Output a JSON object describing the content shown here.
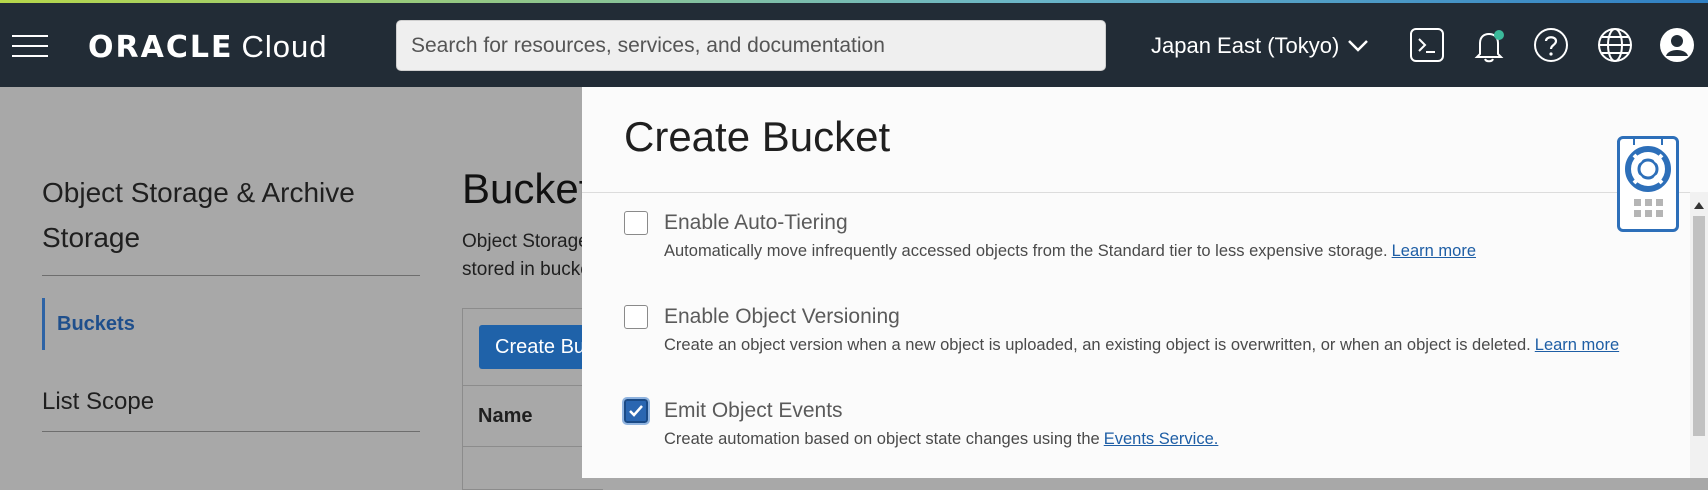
{
  "header": {
    "brand": "ORACLE",
    "product": "Cloud",
    "search_placeholder": "Search for resources, services, and documentation",
    "region": "Japan East (Tokyo)"
  },
  "nav": {
    "title": "Object Storage & Archive Storage",
    "active_item": "Buckets",
    "scope_label": "List Scope"
  },
  "background_page": {
    "heading": "Buckets",
    "description_line1": "Object Storage",
    "description_line2": "stored in buckets",
    "create_button": "Create Bucket",
    "column_name": "Name"
  },
  "drawer": {
    "title": "Create Bucket",
    "options": [
      {
        "label": "Enable Auto-Tiering",
        "checked": false,
        "description": "Automatically move infrequently accessed objects from the Standard tier to less expensive storage.",
        "link": "Learn more"
      },
      {
        "label": "Enable Object Versioning",
        "checked": false,
        "description": "Create an object version when a new object is uploaded, an existing object is overwritten, or when an object is deleted.",
        "link": "Learn more"
      },
      {
        "label": "Emit Object Events",
        "checked": true,
        "description": "Create automation based on object state changes using the",
        "link": "Events Service."
      }
    ]
  },
  "colors": {
    "header_bg": "#222c36",
    "accent_blue": "#2a66b1",
    "link": "#1e5ea5",
    "notification_dot": "#3bb99a"
  }
}
